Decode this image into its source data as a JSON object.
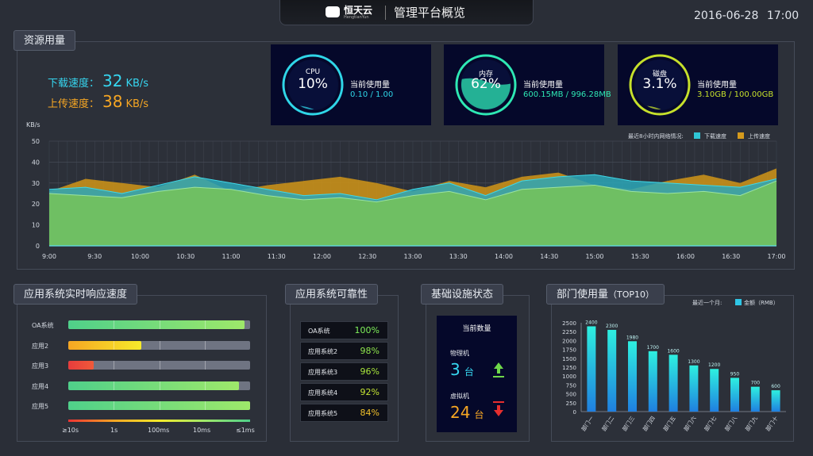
{
  "header": {
    "logo_name": "恒天云",
    "logo_sub": "HengtianYun",
    "title": "管理平台概览",
    "date": "2016-06-28",
    "time": "17:00"
  },
  "resource": {
    "title": "资源用量",
    "download_label": "下载速度：",
    "download_value": "32",
    "upload_label": "上传速度：",
    "upload_value": "38",
    "unit": "KB/s",
    "gauges": [
      {
        "label": "CPU",
        "value": "10%",
        "pct": 10,
        "current_title": "当前使用量",
        "current_value": "0.10 / 1.00",
        "color": "#2fd6e8"
      },
      {
        "label": "内存",
        "value": "62%",
        "pct": 62,
        "current_title": "当前使用量",
        "current_value": "600.15MB / 996.28MB",
        "color": "#2ee8b4"
      },
      {
        "label": "磁盘",
        "value": "3.1%",
        "pct": 3.1,
        "current_title": "当前使用量",
        "current_value": "3.10GB / 100.00GB",
        "color": "#c6e02b"
      }
    ]
  },
  "net_chart": {
    "ylabel": "KB/s",
    "legend_title": "最近8小时内网络情况:",
    "legend": [
      {
        "name": "下载速度",
        "color": "#2fc6d6"
      },
      {
        "name": "上传速度",
        "color": "#d49a1d"
      }
    ]
  },
  "response": {
    "title": "应用系统实时响应速度",
    "scale": [
      "≥10s",
      "1s",
      "100ms",
      "10ms",
      "≤1ms"
    ]
  },
  "reliability": {
    "title": "应用系统可靠性",
    "rows": [
      {
        "name": "OA系统",
        "value": "100%",
        "color": "#7ff05a"
      },
      {
        "name": "应用系统2",
        "value": "98%",
        "color": "#8fe64c"
      },
      {
        "name": "应用系统3",
        "value": "96%",
        "color": "#a8e63b"
      },
      {
        "name": "应用系统4",
        "value": "92%",
        "color": "#c4e432"
      },
      {
        "name": "应用系统5",
        "value": "84%",
        "color": "#f0c02a"
      }
    ]
  },
  "infra": {
    "title": "基础设施状态",
    "card_title": "当前数量",
    "physical_label": "物理机",
    "physical_value": "3",
    "virtual_label": "虚拟机",
    "virtual_value": "24",
    "unit": "台"
  },
  "dept": {
    "title": "部门使用量",
    "title_suffix": "（TOP10）",
    "legend_prefix": "最近一个月:",
    "legend_series": "金额（RMB）"
  },
  "chart_data": [
    {
      "type": "area",
      "x": [
        "9:00",
        "9:30",
        "10:00",
        "10:30",
        "11:00",
        "11:30",
        "12:00",
        "12:30",
        "13:00",
        "13:30",
        "14:00",
        "14:30",
        "15:00",
        "15:30",
        "16:00",
        "16:30",
        "17:00"
      ],
      "ylabel": "KB/s",
      "ylim": [
        0,
        50
      ],
      "yticks": [
        0,
        10,
        20,
        30,
        40,
        50
      ],
      "grid": true,
      "legend_position": "top-right",
      "series": [
        {
          "name": "下载速度",
          "values": [
            27,
            28,
            25,
            29,
            33,
            30,
            27,
            24,
            25,
            22,
            27,
            30,
            24,
            31,
            33,
            34,
            31,
            30,
            29,
            28,
            32
          ]
        },
        {
          "name": "上传速度",
          "values": [
            26,
            32,
            30,
            28,
            34,
            26,
            29,
            31,
            33,
            30,
            26,
            31,
            28,
            33,
            35,
            29,
            27,
            31,
            34,
            30,
            37
          ]
        },
        {
          "name": "base",
          "values": [
            25,
            24,
            23,
            26,
            28,
            27,
            24,
            22,
            23,
            21,
            24,
            26,
            22,
            27,
            28,
            29,
            26,
            25,
            26,
            24,
            31
          ]
        }
      ]
    },
    {
      "type": "bar",
      "title": "",
      "categories": [
        "部门一",
        "部门二",
        "部门三",
        "部门四",
        "部门五",
        "部门六",
        "部门七",
        "部门八",
        "部门九",
        "部门十"
      ],
      "values": [
        2400,
        2300,
        1980,
        1700,
        1600,
        1300,
        1200,
        950,
        700,
        600
      ],
      "ylim": [
        0,
        2500
      ],
      "yticks": [
        0,
        250,
        500,
        750,
        1000,
        1250,
        1500,
        1750,
        2000,
        2250,
        2500
      ],
      "series_name": "金额（RMB）"
    },
    {
      "type": "bar",
      "orientation": "horizontal",
      "categories": [
        "OA系统",
        "应用2",
        "应用3",
        "应用4",
        "应用5"
      ],
      "values": [
        0.97,
        0.4,
        0.14,
        0.94,
        1.0
      ],
      "colors": [
        [
          "#4fd08a",
          "#9ee86a"
        ],
        [
          "#f6a623",
          "#f6ea2a"
        ],
        [
          "#e73c3c",
          "#f05a3a"
        ],
        [
          "#4fd08a",
          "#9ee86a"
        ],
        [
          "#4fd08a",
          "#9ee86a"
        ]
      ]
    }
  ]
}
